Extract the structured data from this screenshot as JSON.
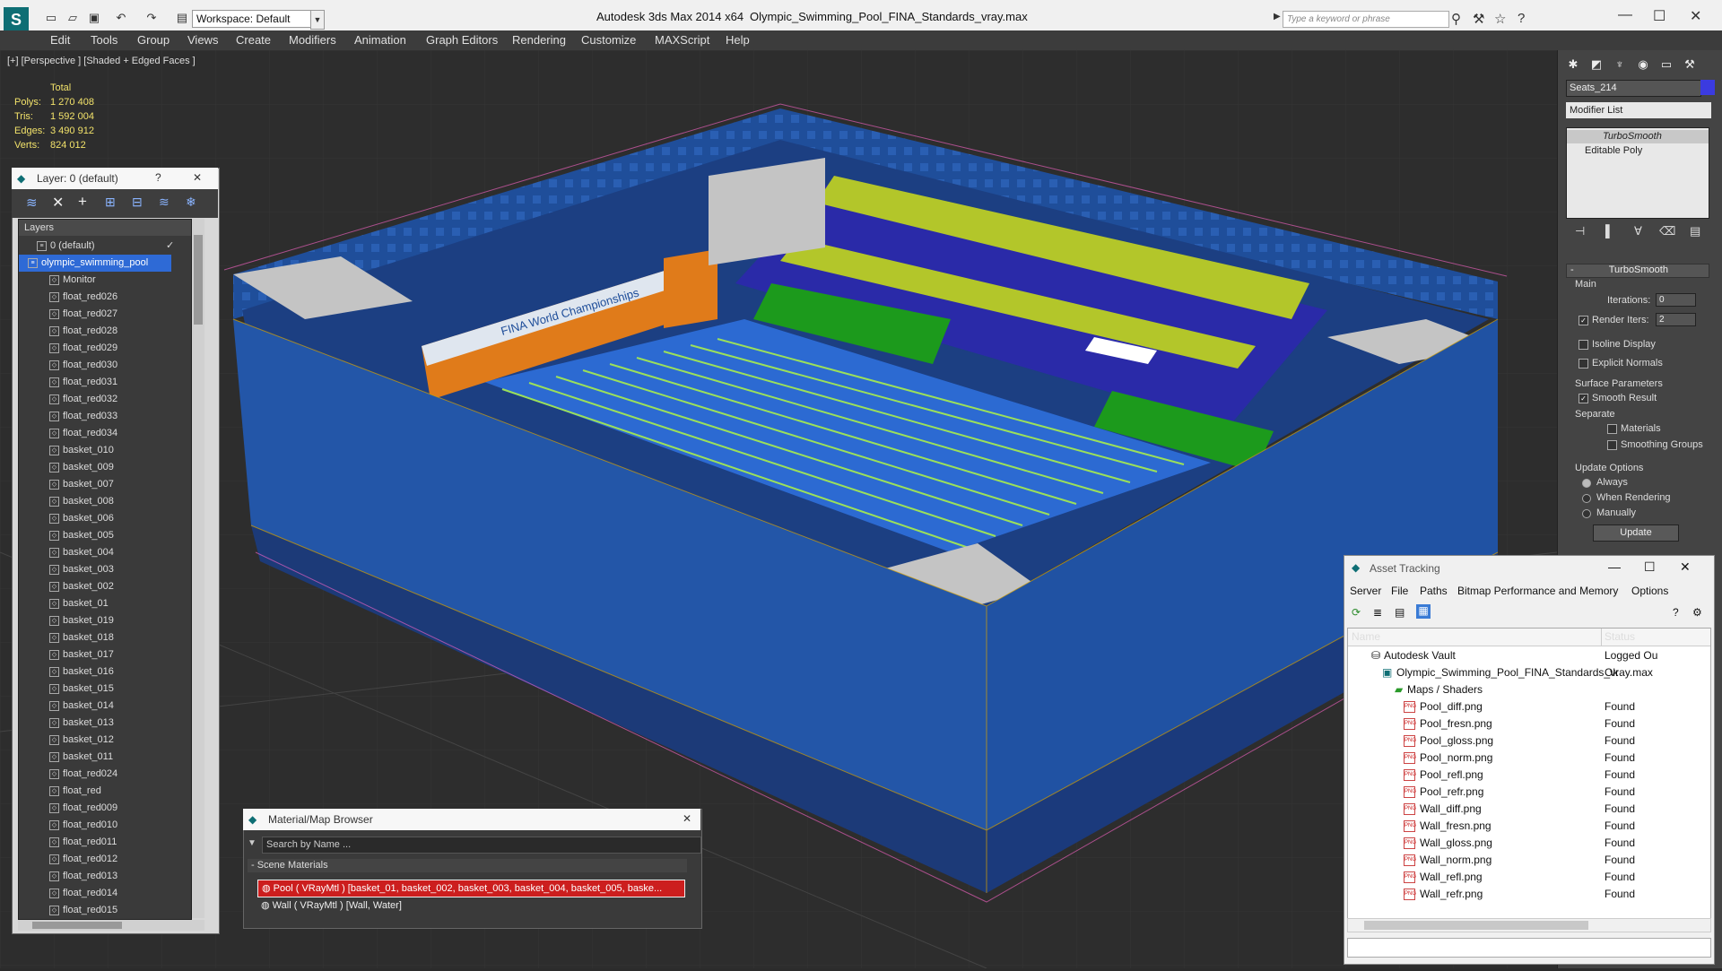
{
  "titlebar": {
    "app_title": "Autodesk 3ds Max  2014 x64",
    "document": "Olympic_Swimming_Pool_FINA_Standards_vray.max",
    "workspace": "Workspace: Default",
    "search_placeholder": "Type a keyword or phrase"
  },
  "menu": [
    "Edit",
    "Tools",
    "Group",
    "Views",
    "Create",
    "Modifiers",
    "Animation",
    "Graph Editors",
    "Rendering",
    "Customize",
    "MAXScript",
    "Help"
  ],
  "viewport": {
    "label": "[+] [Perspective ] [Shaded + Edged Faces ]",
    "stats_header": "Total",
    "stats": [
      {
        "label": "Polys:",
        "value": "1 270 408"
      },
      {
        "label": "Tris:",
        "value": "1 592 004"
      },
      {
        "label": "Edges:",
        "value": "3 490 912"
      },
      {
        "label": "Verts:",
        "value": "824 012"
      }
    ],
    "banner_text": "FINA World Championships"
  },
  "layer_panel": {
    "title": "Layer: 0 (default)",
    "help": "?",
    "close": "✕",
    "list_header": "Layers",
    "default_layer": "0 (default)",
    "selected_layer": "olympic_swimming_pool",
    "objects": [
      "Monitor",
      "float_red026",
      "float_red027",
      "float_red028",
      "float_red029",
      "float_red030",
      "float_red031",
      "float_red032",
      "float_red033",
      "float_red034",
      "basket_010",
      "basket_009",
      "basket_007",
      "basket_008",
      "basket_006",
      "basket_005",
      "basket_004",
      "basket_003",
      "basket_002",
      "basket_01",
      "basket_019",
      "basket_018",
      "basket_017",
      "basket_016",
      "basket_015",
      "basket_014",
      "basket_013",
      "basket_012",
      "basket_011",
      "float_red024",
      "float_red",
      "float_red009",
      "float_red010",
      "float_red011",
      "float_red012",
      "float_red013",
      "float_red014",
      "float_red015"
    ]
  },
  "material_browser": {
    "title": "Material/Map Browser",
    "search_placeholder": "Search by Name ...",
    "section": "- Scene Materials",
    "materials": [
      "Pool  ( VRayMtl ) [basket_01, basket_002, basket_003, basket_004, basket_005, baske...",
      "Wall  ( VRayMtl ) [Wall, Water]"
    ]
  },
  "command_panel": {
    "object_name": "Seats_214",
    "object_color": "#3b3be0",
    "modifier_list": "Modifier List",
    "stack": [
      "TurboSmooth",
      "Editable Poly"
    ],
    "rollout_title": "TurboSmooth",
    "main_group": "Main",
    "iterations_label": "Iterations:",
    "iterations_value": "0",
    "render_iters_label": "Render Iters:",
    "render_iters_value": "2",
    "isoline": "Isoline Display",
    "explicit_normals": "Explicit Normals",
    "surface_params": "Surface Parameters",
    "smooth_result": "Smooth Result",
    "separate": "Separate",
    "materials": "Materials",
    "smoothing_groups": "Smoothing Groups",
    "update_options": "Update Options",
    "always": "Always",
    "when_rendering": "When Rendering",
    "manually": "Manually",
    "update_button": "Update"
  },
  "asset_tracking": {
    "title": "Asset Tracking",
    "menu": [
      "Server",
      "File",
      "Paths",
      "Bitmap Performance and Memory",
      "Options"
    ],
    "col_name": "Name",
    "col_status": "Status",
    "vault": {
      "name": "Autodesk Vault",
      "status": "Logged Ou"
    },
    "scene": {
      "name": "Olympic_Swimming_Pool_FINA_Standards_vray.max",
      "status": "Ok"
    },
    "maps_folder": "Maps / Shaders",
    "files": [
      {
        "name": "Pool_diff.png",
        "status": "Found"
      },
      {
        "name": "Pool_fresn.png",
        "status": "Found"
      },
      {
        "name": "Pool_gloss.png",
        "status": "Found"
      },
      {
        "name": "Pool_norm.png",
        "status": "Found"
      },
      {
        "name": "Pool_refl.png",
        "status": "Found"
      },
      {
        "name": "Pool_refr.png",
        "status": "Found"
      },
      {
        "name": "Wall_diff.png",
        "status": "Found"
      },
      {
        "name": "Wall_fresn.png",
        "status": "Found"
      },
      {
        "name": "Wall_gloss.png",
        "status": "Found"
      },
      {
        "name": "Wall_norm.png",
        "status": "Found"
      },
      {
        "name": "Wall_refl.png",
        "status": "Found"
      },
      {
        "name": "Wall_refr.png",
        "status": "Found"
      }
    ]
  }
}
